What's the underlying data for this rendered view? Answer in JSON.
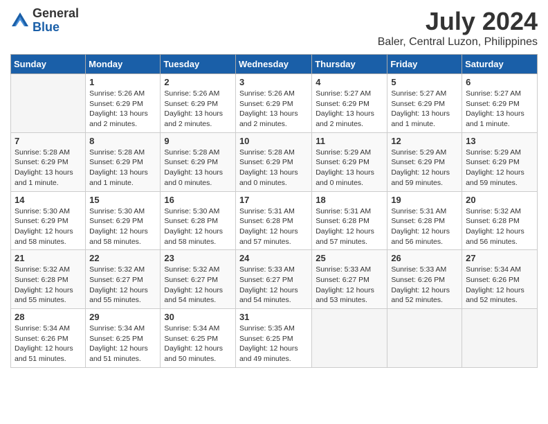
{
  "logo": {
    "general": "General",
    "blue": "Blue"
  },
  "title": {
    "month_year": "July 2024",
    "location": "Baler, Central Luzon, Philippines"
  },
  "headers": [
    "Sunday",
    "Monday",
    "Tuesday",
    "Wednesday",
    "Thursday",
    "Friday",
    "Saturday"
  ],
  "weeks": [
    [
      {
        "day": "",
        "sunrise": "",
        "sunset": "",
        "daylight": ""
      },
      {
        "day": "1",
        "sunrise": "Sunrise: 5:26 AM",
        "sunset": "Sunset: 6:29 PM",
        "daylight": "Daylight: 13 hours and 2 minutes."
      },
      {
        "day": "2",
        "sunrise": "Sunrise: 5:26 AM",
        "sunset": "Sunset: 6:29 PM",
        "daylight": "Daylight: 13 hours and 2 minutes."
      },
      {
        "day": "3",
        "sunrise": "Sunrise: 5:26 AM",
        "sunset": "Sunset: 6:29 PM",
        "daylight": "Daylight: 13 hours and 2 minutes."
      },
      {
        "day": "4",
        "sunrise": "Sunrise: 5:27 AM",
        "sunset": "Sunset: 6:29 PM",
        "daylight": "Daylight: 13 hours and 2 minutes."
      },
      {
        "day": "5",
        "sunrise": "Sunrise: 5:27 AM",
        "sunset": "Sunset: 6:29 PM",
        "daylight": "Daylight: 13 hours and 1 minute."
      },
      {
        "day": "6",
        "sunrise": "Sunrise: 5:27 AM",
        "sunset": "Sunset: 6:29 PM",
        "daylight": "Daylight: 13 hours and 1 minute."
      }
    ],
    [
      {
        "day": "7",
        "sunrise": "Sunrise: 5:28 AM",
        "sunset": "Sunset: 6:29 PM",
        "daylight": "Daylight: 13 hours and 1 minute."
      },
      {
        "day": "8",
        "sunrise": "Sunrise: 5:28 AM",
        "sunset": "Sunset: 6:29 PM",
        "daylight": "Daylight: 13 hours and 1 minute."
      },
      {
        "day": "9",
        "sunrise": "Sunrise: 5:28 AM",
        "sunset": "Sunset: 6:29 PM",
        "daylight": "Daylight: 13 hours and 0 minutes."
      },
      {
        "day": "10",
        "sunrise": "Sunrise: 5:28 AM",
        "sunset": "Sunset: 6:29 PM",
        "daylight": "Daylight: 13 hours and 0 minutes."
      },
      {
        "day": "11",
        "sunrise": "Sunrise: 5:29 AM",
        "sunset": "Sunset: 6:29 PM",
        "daylight": "Daylight: 13 hours and 0 minutes."
      },
      {
        "day": "12",
        "sunrise": "Sunrise: 5:29 AM",
        "sunset": "Sunset: 6:29 PM",
        "daylight": "Daylight: 12 hours and 59 minutes."
      },
      {
        "day": "13",
        "sunrise": "Sunrise: 5:29 AM",
        "sunset": "Sunset: 6:29 PM",
        "daylight": "Daylight: 12 hours and 59 minutes."
      }
    ],
    [
      {
        "day": "14",
        "sunrise": "Sunrise: 5:30 AM",
        "sunset": "Sunset: 6:29 PM",
        "daylight": "Daylight: 12 hours and 58 minutes."
      },
      {
        "day": "15",
        "sunrise": "Sunrise: 5:30 AM",
        "sunset": "Sunset: 6:29 PM",
        "daylight": "Daylight: 12 hours and 58 minutes."
      },
      {
        "day": "16",
        "sunrise": "Sunrise: 5:30 AM",
        "sunset": "Sunset: 6:28 PM",
        "daylight": "Daylight: 12 hours and 58 minutes."
      },
      {
        "day": "17",
        "sunrise": "Sunrise: 5:31 AM",
        "sunset": "Sunset: 6:28 PM",
        "daylight": "Daylight: 12 hours and 57 minutes."
      },
      {
        "day": "18",
        "sunrise": "Sunrise: 5:31 AM",
        "sunset": "Sunset: 6:28 PM",
        "daylight": "Daylight: 12 hours and 57 minutes."
      },
      {
        "day": "19",
        "sunrise": "Sunrise: 5:31 AM",
        "sunset": "Sunset: 6:28 PM",
        "daylight": "Daylight: 12 hours and 56 minutes."
      },
      {
        "day": "20",
        "sunrise": "Sunrise: 5:32 AM",
        "sunset": "Sunset: 6:28 PM",
        "daylight": "Daylight: 12 hours and 56 minutes."
      }
    ],
    [
      {
        "day": "21",
        "sunrise": "Sunrise: 5:32 AM",
        "sunset": "Sunset: 6:28 PM",
        "daylight": "Daylight: 12 hours and 55 minutes."
      },
      {
        "day": "22",
        "sunrise": "Sunrise: 5:32 AM",
        "sunset": "Sunset: 6:27 PM",
        "daylight": "Daylight: 12 hours and 55 minutes."
      },
      {
        "day": "23",
        "sunrise": "Sunrise: 5:32 AM",
        "sunset": "Sunset: 6:27 PM",
        "daylight": "Daylight: 12 hours and 54 minutes."
      },
      {
        "day": "24",
        "sunrise": "Sunrise: 5:33 AM",
        "sunset": "Sunset: 6:27 PM",
        "daylight": "Daylight: 12 hours and 54 minutes."
      },
      {
        "day": "25",
        "sunrise": "Sunrise: 5:33 AM",
        "sunset": "Sunset: 6:27 PM",
        "daylight": "Daylight: 12 hours and 53 minutes."
      },
      {
        "day": "26",
        "sunrise": "Sunrise: 5:33 AM",
        "sunset": "Sunset: 6:26 PM",
        "daylight": "Daylight: 12 hours and 52 minutes."
      },
      {
        "day": "27",
        "sunrise": "Sunrise: 5:34 AM",
        "sunset": "Sunset: 6:26 PM",
        "daylight": "Daylight: 12 hours and 52 minutes."
      }
    ],
    [
      {
        "day": "28",
        "sunrise": "Sunrise: 5:34 AM",
        "sunset": "Sunset: 6:26 PM",
        "daylight": "Daylight: 12 hours and 51 minutes."
      },
      {
        "day": "29",
        "sunrise": "Sunrise: 5:34 AM",
        "sunset": "Sunset: 6:25 PM",
        "daylight": "Daylight: 12 hours and 51 minutes."
      },
      {
        "day": "30",
        "sunrise": "Sunrise: 5:34 AM",
        "sunset": "Sunset: 6:25 PM",
        "daylight": "Daylight: 12 hours and 50 minutes."
      },
      {
        "day": "31",
        "sunrise": "Sunrise: 5:35 AM",
        "sunset": "Sunset: 6:25 PM",
        "daylight": "Daylight: 12 hours and 49 minutes."
      },
      {
        "day": "",
        "sunrise": "",
        "sunset": "",
        "daylight": ""
      },
      {
        "day": "",
        "sunrise": "",
        "sunset": "",
        "daylight": ""
      },
      {
        "day": "",
        "sunrise": "",
        "sunset": "",
        "daylight": ""
      }
    ]
  ]
}
